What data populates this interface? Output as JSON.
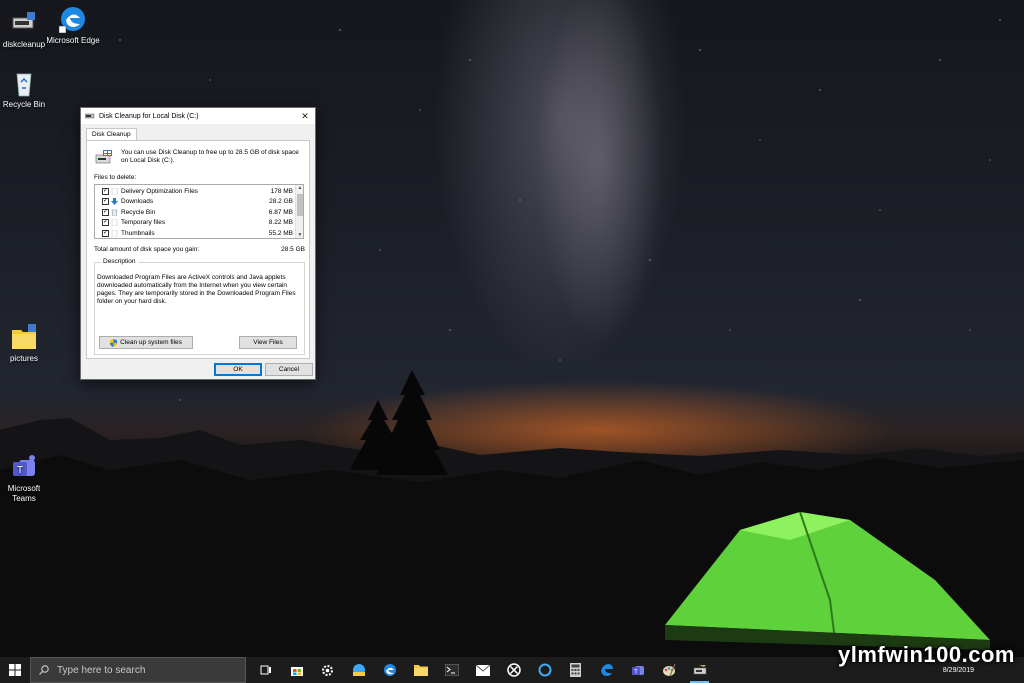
{
  "desktop": {
    "icons": [
      {
        "label": "diskcleanup"
      },
      {
        "label": "Microsoft Edge"
      },
      {
        "label": "Recycle Bin"
      },
      {
        "label": "pictures"
      },
      {
        "label": "Microsoft Teams"
      }
    ]
  },
  "dialog": {
    "title": "Disk Cleanup for Local Disk  (C:)",
    "close_glyph": "✕",
    "tab_label": "Disk Cleanup",
    "intro_text": "You can use Disk Cleanup to free up to 28.5 GB of disk space on Local Disk  (C:).",
    "files_label": "Files to delete:",
    "files": [
      {
        "name": "Delivery Optimization Files",
        "size": "178 MB",
        "checked": true,
        "icon": "blank-file-icon"
      },
      {
        "name": "Downloads",
        "size": "28.2 GB",
        "checked": true,
        "icon": "download-arrow-icon"
      },
      {
        "name": "Recycle Bin",
        "size": "6.87 MB",
        "checked": true,
        "icon": "recycle-bin-icon"
      },
      {
        "name": "Temporary files",
        "size": "8.22 MB",
        "checked": true,
        "icon": "blank-file-icon"
      },
      {
        "name": "Thumbnails",
        "size": "55.2 MB",
        "checked": true,
        "icon": "blank-file-icon"
      }
    ],
    "total_label": "Total amount of disk space you gain:",
    "total_value": "28.5 GB",
    "description_legend": "Description",
    "description_text": "Downloaded Program Files are ActiveX controls and Java applets downloaded automatically from the Internet when you view certain pages. They are temporarily stored in the Downloaded Program Files folder on your hard disk.",
    "cleanup_system_label": "Clean up system files",
    "view_files_label": "View Files",
    "ok_label": "OK",
    "cancel_label": "Cancel",
    "check_glyph": "✓"
  },
  "taskbar": {
    "search_placeholder": "Type here to search",
    "apps": [
      "task-view-icon",
      "store-icon",
      "settings-icon",
      "edge-beta-icon",
      "edge-dev-icon",
      "file-explorer-icon",
      "terminal-icon",
      "mail-icon",
      "xbox-icon",
      "cortana-icon",
      "calculator-icon",
      "edge-icon",
      "teams-icon",
      "paint-icon",
      "disk-cleanup-icon"
    ],
    "tray_date": "8/29/2019"
  },
  "watermark": "ylmfwin100.com",
  "colors": {
    "accent": "#0078d7",
    "taskbar": "#1c1c1c",
    "tent": "#5fd13a"
  }
}
